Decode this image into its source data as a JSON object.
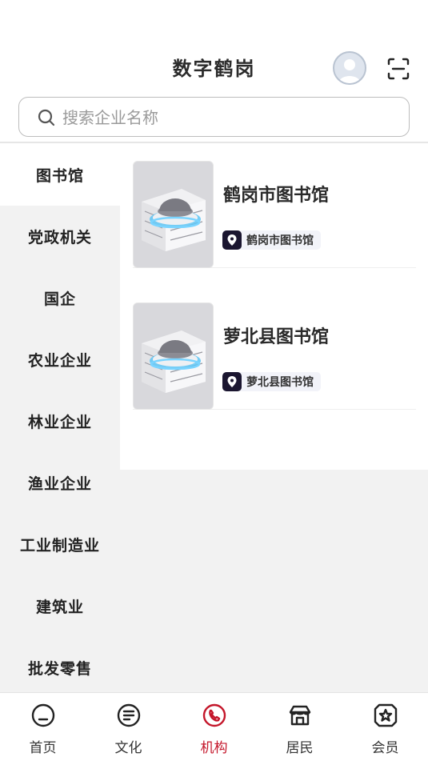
{
  "header": {
    "app_title": "数字鹤岗",
    "avatar_icon": "user-avatar-icon",
    "scan_icon": "scan-icon"
  },
  "search": {
    "placeholder": "搜索企业名称",
    "value": ""
  },
  "sidebar": {
    "items": [
      {
        "label": "图书馆",
        "active": true
      },
      {
        "label": "党政机关"
      },
      {
        "label": "国企"
      },
      {
        "label": "农业企业"
      },
      {
        "label": "林业企业"
      },
      {
        "label": "渔业企业"
      },
      {
        "label": "工业制造业"
      },
      {
        "label": "建筑业"
      },
      {
        "label": "批发零售"
      }
    ]
  },
  "cards": [
    {
      "title": "鹤岗市图书馆",
      "location": "鹤岗市图书馆",
      "image": "library-building-image"
    },
    {
      "title": "萝北县图书馆",
      "location": "萝北县图书馆",
      "image": "library-building-image"
    }
  ],
  "tabbar": {
    "items": [
      {
        "label": "首页",
        "icon": "home-icon"
      },
      {
        "label": "文化",
        "icon": "culture-icon"
      },
      {
        "label": "机构",
        "icon": "institution-icon",
        "active": true
      },
      {
        "label": "居民",
        "icon": "resident-icon"
      },
      {
        "label": "会员",
        "icon": "member-icon"
      }
    ]
  },
  "colors": {
    "accent": "#c4162a",
    "location_tag_icon_bg": "#1b1630",
    "sidebar_bg": "#f2f2f2"
  }
}
